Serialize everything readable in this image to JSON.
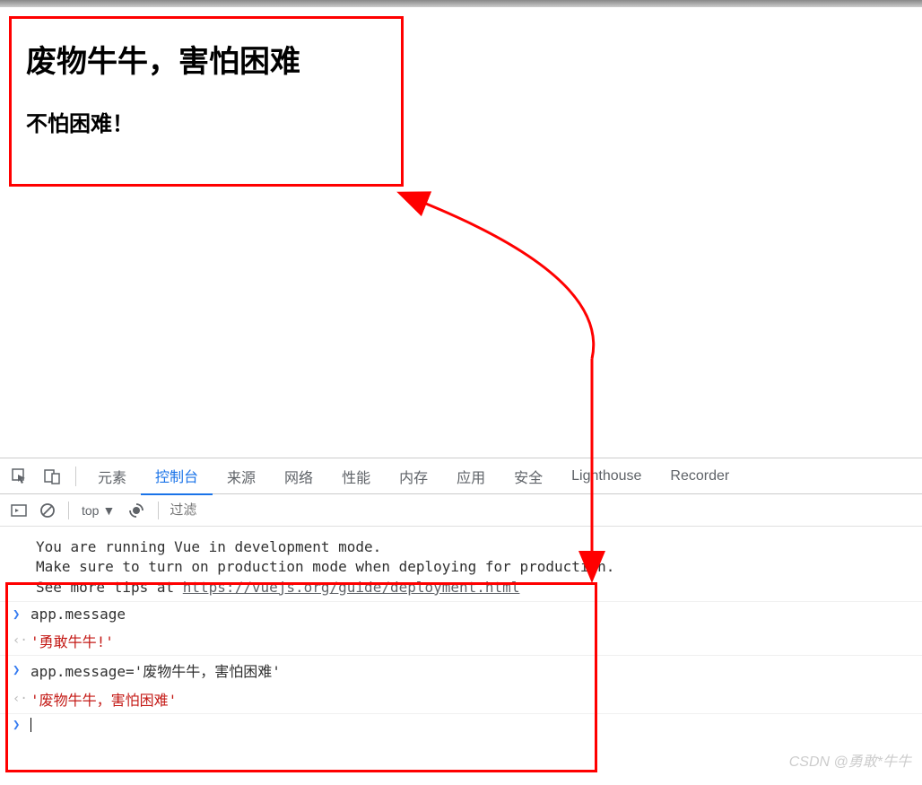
{
  "page": {
    "heading1": "废物牛牛，害怕困难",
    "heading2": "不怕困难！"
  },
  "devtools": {
    "tabs": [
      "元素",
      "控制台",
      "来源",
      "网络",
      "性能",
      "内存",
      "应用",
      "安全",
      "Lighthouse",
      "Recorder"
    ],
    "active_tab_index": 1,
    "context": "top",
    "filter_placeholder": "过滤"
  },
  "console": {
    "warning_line1": "You are running Vue in development mode.",
    "warning_line2": "Make sure to turn on production mode when deploying for production.",
    "warning_line3_prefix": "See more tips at ",
    "warning_link": "https://vuejs.org/guide/deployment.html",
    "entries": [
      {
        "type": "input",
        "text": "app.message"
      },
      {
        "type": "output",
        "text": "'勇敢牛牛!'"
      },
      {
        "type": "input",
        "text": "app.message='废物牛牛，害怕困难'"
      },
      {
        "type": "output",
        "text": "'废物牛牛，害怕困难'"
      }
    ]
  },
  "watermark": "CSDN @勇敢*牛牛"
}
